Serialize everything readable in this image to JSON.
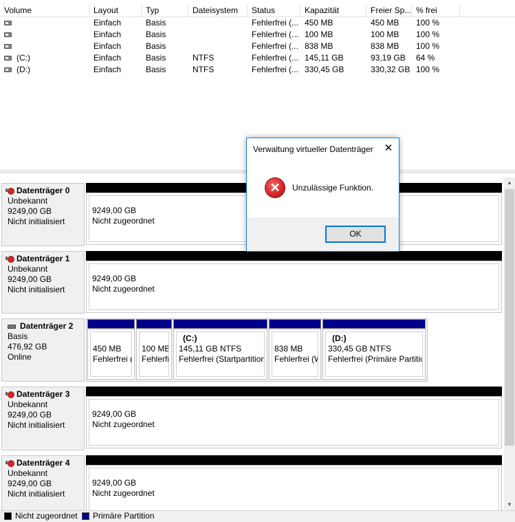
{
  "volume_list": {
    "columns": [
      "Volume",
      "Layout",
      "Typ",
      "Dateisystem",
      "Status",
      "Kapazität",
      "Freier Sp...",
      "% frei"
    ],
    "rows": [
      {
        "volume": "",
        "layout": "Einfach",
        "typ": "Basis",
        "fs": "",
        "status": "Fehlerfrei (...",
        "capacity": "450 MB",
        "free": "450 MB",
        "pct": "100 %"
      },
      {
        "volume": "",
        "layout": "Einfach",
        "typ": "Basis",
        "fs": "",
        "status": "Fehlerfrei (...",
        "capacity": "100 MB",
        "free": "100 MB",
        "pct": "100 %"
      },
      {
        "volume": "",
        "layout": "Einfach",
        "typ": "Basis",
        "fs": "",
        "status": "Fehlerfrei (...",
        "capacity": "838 MB",
        "free": "838 MB",
        "pct": "100 %"
      },
      {
        "volume": "(C:)",
        "layout": "Einfach",
        "typ": "Basis",
        "fs": "NTFS",
        "status": "Fehlerfrei (...",
        "capacity": "145,11 GB",
        "free": "93,19 GB",
        "pct": "64 %"
      },
      {
        "volume": "(D:)",
        "layout": "Einfach",
        "typ": "Basis",
        "fs": "NTFS",
        "status": "Fehlerfrei (...",
        "capacity": "330,45 GB",
        "free": "330,32 GB",
        "pct": "100 %"
      }
    ]
  },
  "disks": [
    {
      "name": "Datenträger 0",
      "type": "Unbekannt",
      "size": "9249,00 GB",
      "state": "Nicht initialisiert",
      "area_size": "9249,00 GB",
      "area_label": "Nicht zugeordnet"
    },
    {
      "name": "Datenträger 1",
      "type": "Unbekannt",
      "size": "9249,00 GB",
      "state": "Nicht initialisiert",
      "area_size": "9249,00 GB",
      "area_label": "Nicht zugeordnet"
    },
    {
      "name": "Datenträger 2",
      "type": "Basis",
      "size": "476,92 GB",
      "state": "Online"
    },
    {
      "name": "Datenträger 3",
      "type": "Unbekannt",
      "size": "9249,00 GB",
      "state": "Nicht initialisiert",
      "area_size": "9249,00 GB",
      "area_label": "Nicht zugeordnet"
    },
    {
      "name": "Datenträger 4",
      "type": "Unbekannt",
      "size": "9249,00 GB",
      "state": "Nicht initialisiert",
      "area_size": "9249,00 GB",
      "area_label": "Nicht zugeordnet"
    }
  ],
  "disk2_partitions": [
    {
      "title": "",
      "size": "450 MB",
      "status": "Fehlerfrei ("
    },
    {
      "title": "",
      "size": "100 MB",
      "status": "Fehlerfrei"
    },
    {
      "title": "(C:)",
      "size": "145,11 GB NTFS",
      "status": "Fehlerfrei (Startpartition"
    },
    {
      "title": "",
      "size": "838 MB",
      "status": "Fehlerfrei (W"
    },
    {
      "title": "(D:)",
      "size": "330,45 GB NTFS",
      "status": "Fehlerfrei (Primäre Partitic"
    }
  ],
  "legend": {
    "unallocated": "Nicht zugeordnet",
    "primary": "Primäre Partition"
  },
  "dialog": {
    "title": "Verwaltung virtueller Datenträger",
    "message": "Unzulässige Funktion.",
    "ok": "OK",
    "close": "✕",
    "icon": "error-icon"
  },
  "colors": {
    "primary_partition": "#00008b",
    "unallocated": "#000000",
    "dialog_border": "#1883d7",
    "error_red": "#d8282c"
  }
}
